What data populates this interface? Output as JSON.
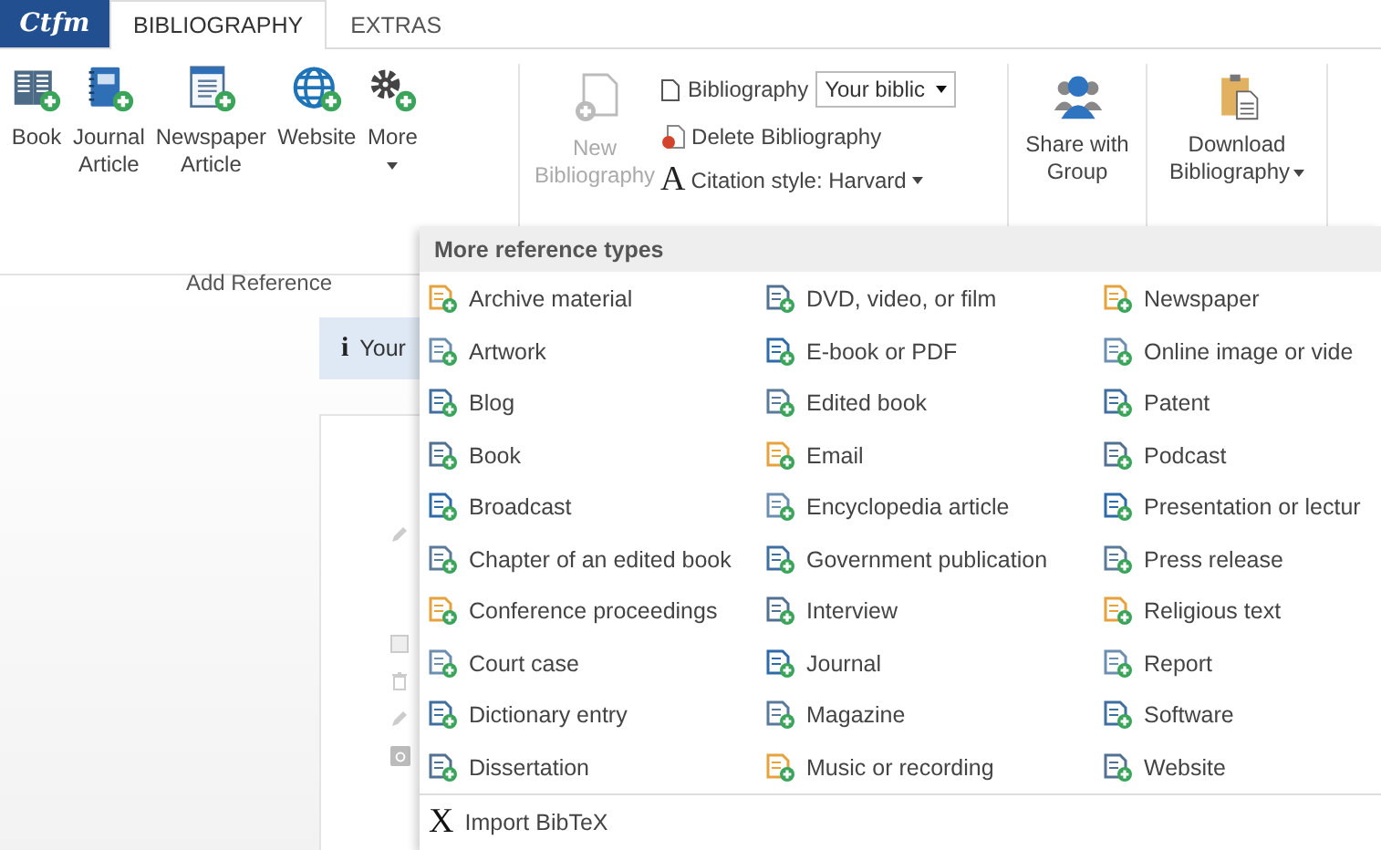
{
  "logo": "Ctfm",
  "tabs": [
    {
      "label": "BIBLIOGRAPHY",
      "selected": true
    },
    {
      "label": "EXTRAS",
      "selected": false
    }
  ],
  "ribbon": {
    "add_reference": {
      "buttons": [
        {
          "label": "Book"
        },
        {
          "label": "Journal\nArticle"
        },
        {
          "label": "Newspaper\nArticle"
        },
        {
          "label": "Website"
        },
        {
          "label": "More",
          "dropdown": true
        }
      ],
      "group_label": "Add Reference"
    },
    "new_bibliography": {
      "label": "New\nBibliography",
      "disabled": true
    },
    "bibliography_select": {
      "label": "Bibliography",
      "value": "Your biblic"
    },
    "delete_bibliography": {
      "label": "Delete Bibliography"
    },
    "citation_style": {
      "glyph": "A",
      "label": "Citation style: Harvard"
    },
    "share": {
      "label": "Share with\nGroup"
    },
    "download": {
      "label": "Download\nBibliography",
      "dropdown": true
    }
  },
  "page": {
    "info_glyph": "i",
    "banner": "Your"
  },
  "menu": {
    "title": "More reference types",
    "columns": [
      [
        "Archive material",
        "Artwork",
        "Blog",
        "Book",
        "Broadcast",
        "Chapter of an edited book",
        "Conference proceedings",
        "Court case",
        "Dictionary entry",
        "Dissertation"
      ],
      [
        "DVD, video, or film",
        "E-book or PDF",
        "Edited book",
        "Email",
        "Encyclopedia article",
        "Government publication",
        "Interview",
        "Journal",
        "Magazine",
        "Music or recording"
      ],
      [
        "Newspaper",
        "Online image or vide",
        "Patent",
        "Podcast",
        "Presentation or lectur",
        "Press release",
        "Religious text",
        "Report",
        "Software",
        "Website"
      ]
    ],
    "import": {
      "glyph": "X",
      "label": "Import BibTeX"
    }
  }
}
